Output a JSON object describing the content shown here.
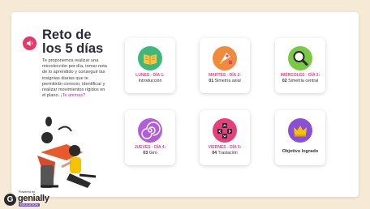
{
  "slide": {
    "title": "Reto de\nlos 5 días",
    "description": "Te proponemos realizar una microlección por día, tomar nota de lo aprendido y conseguir las insignias diarias que te permitirán conocer, identificar y realizar movimientos rígidos en el plano. ",
    "description_link": "¡Te animas?"
  },
  "cards": [
    {
      "day": "LUNES - DÍA 1:",
      "num": "",
      "topic": "Introducción",
      "icon": "book-icon",
      "color": "#3cb97a"
    },
    {
      "day": "MARTES - DÍA 2:",
      "num": "01",
      "topic": "Simetría axial",
      "icon": "rocket-icon",
      "color": "#f08a3c"
    },
    {
      "day": "MIÉRCOLES - DÍA 3:",
      "num": "02",
      "topic": "Simetría central",
      "icon": "magnifier-icon",
      "color": "#7ac943"
    },
    {
      "day": "JUEVES - DÍA 4:",
      "num": "03",
      "topic": "Giro",
      "icon": "spiral-icon",
      "color": "#b15fd8"
    },
    {
      "day": "VIERNES - DÍA 5:",
      "num": "04",
      "topic": "Traslación",
      "icon": "arrow-keys-icon",
      "color": "#e5407a"
    },
    {
      "day": "",
      "num": "",
      "topic": "Objetivo logrado",
      "icon": "crown-icon",
      "color": "#8a4fd6"
    }
  ],
  "branding": {
    "powered_by": "Powered by",
    "brand": "genially",
    "edition": "EDUCATION"
  }
}
